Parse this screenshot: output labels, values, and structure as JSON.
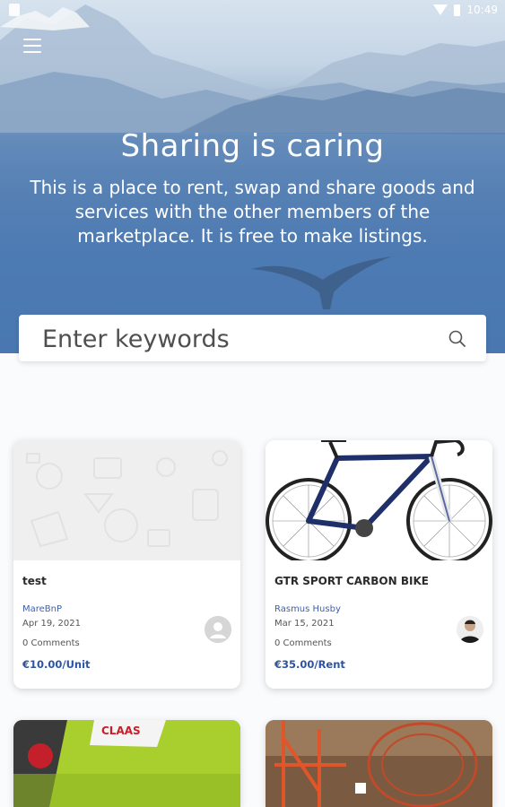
{
  "statusbar": {
    "time": "10:49"
  },
  "hero": {
    "title": "Sharing is caring",
    "subtitle": "This is a place to rent, swap and share goods and services with the other members of the marketplace. It is free to make listings."
  },
  "search": {
    "placeholder": "Enter keywords"
  },
  "listings": [
    {
      "title": "test",
      "author": "MareBnP",
      "date": "Apr 19, 2021",
      "comments": "0 Comments",
      "price": "€10.00/Unit"
    },
    {
      "title": "GTR SPORT CARBON BIKE",
      "author": "Rasmus Husby",
      "date": "Mar 15, 2021",
      "comments": "0 Comments",
      "price": "€35.00/Rent"
    }
  ],
  "colors": {
    "accent": "#2c54a5",
    "author": "#3d5fb0",
    "hero_sky": "#c5d5e6",
    "hero_water": "#4471ae"
  },
  "icons": [
    "menu-icon",
    "search-icon",
    "avatar-placeholder-icon",
    "wifi-icon",
    "battery-icon"
  ]
}
